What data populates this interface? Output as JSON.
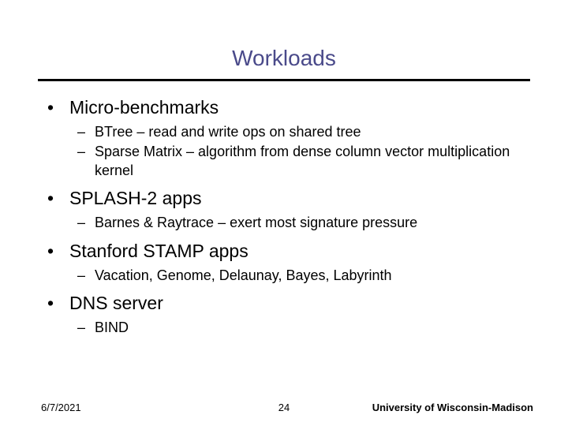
{
  "title": "Workloads",
  "bullets": [
    {
      "label": "Micro-benchmarks",
      "sub": [
        "BTree – read and write ops on shared tree",
        "Sparse Matrix – algorithm from dense column vector multiplication kernel"
      ]
    },
    {
      "label": "SPLASH-2 apps",
      "sub": [
        "Barnes & Raytrace – exert most signature pressure"
      ]
    },
    {
      "label": "Stanford STAMP apps",
      "sub": [
        "Vacation, Genome, Delaunay, Bayes, Labyrinth"
      ]
    },
    {
      "label": "DNS server",
      "sub": [
        "BIND"
      ]
    }
  ],
  "footer": {
    "date": "6/7/2021",
    "page": "24",
    "org": "University of Wisconsin-Madison"
  }
}
